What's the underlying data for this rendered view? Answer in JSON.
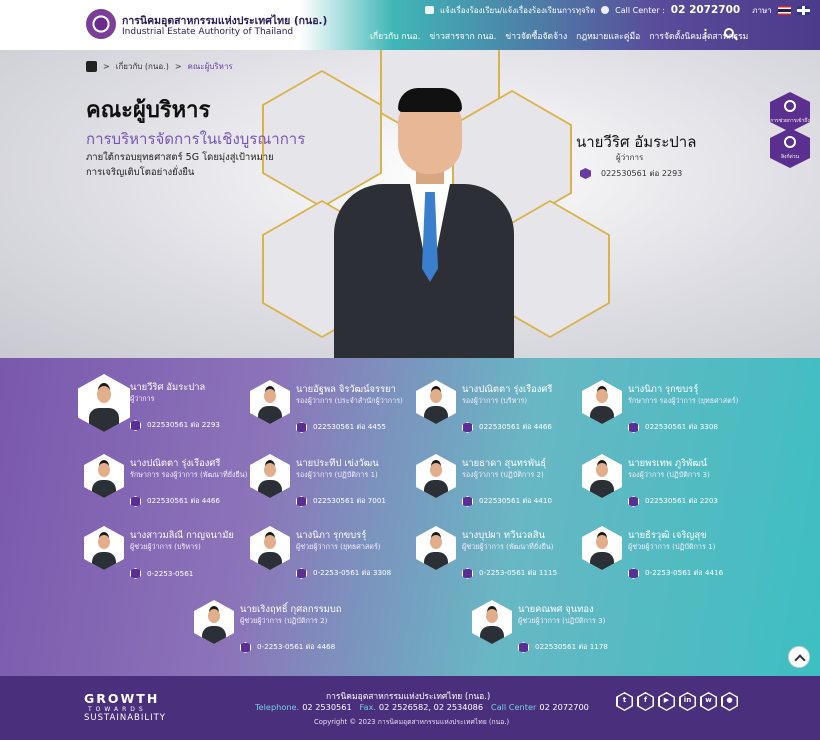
{
  "header": {
    "brand_th": "การนิคมอุตสาหกรรมแห่งประเทศไทย (กนอ.)",
    "brand_en": "Industrial Estate Authority of Thailand",
    "complaint_link": "แจ้งเรื่องร้องเรียน/แจ้งเรื่องร้องเรียนการทุจริต",
    "call_center_label": "Call Center :",
    "call_center_number": "02 2072700",
    "language_label": "ภาษา",
    "nav": [
      "เกี่ยวกับ กนอ.",
      "ข่าวสารจาก กนอ.",
      "ข่าวจัดซื้อจัดจ้าง",
      "กฎหมายและคู่มือ",
      "การจัดตั้งนิคมอุตสาหกรรม"
    ],
    "more_label": "⋮"
  },
  "breadcrumb": {
    "parent": "เกี่ยวกับ (กนอ.)",
    "current": "คณะผู้บริหาร",
    "separator": ">"
  },
  "hero": {
    "title": "คณะผู้บริหาร",
    "subtitle": "การบริหารจัดการในเชิงบูรณาการ",
    "description": "ภายใต้กรอบยุทธศาสตร์ 5G โดยมุ่งสู่เป้าหมายการเจริญเติบโตอย่างยั่งยืน",
    "name": "นายวีริศ อัมระปาล",
    "position": "ผู้ว่าการ",
    "phone": "022530561 ต่อ 2293"
  },
  "side_buttons": [
    "การช่วยการเข้าถึง",
    "ลิงก์ด่วน"
  ],
  "team": [
    {
      "name": "นายวีริศ อัมระปาล",
      "position": "ผู้ว่าการ",
      "phone": "022530561 ต่อ 2293"
    },
    {
      "name": "นายอัฐพล จิรวัฒน์จรรยา",
      "position": "รองผู้ว่าการ (ประจำสำนักผู้ว่าการ)",
      "phone": "022530561 ต่อ 4455"
    },
    {
      "name": "นางปณิตตา รุ่งเรืองศรี",
      "position": "รองผู้ว่าการ (บริหาร)",
      "phone": "022530561 ต่อ 4466"
    },
    {
      "name": "นางนิภา รุกขบรรุ์",
      "position": "รักษาการ รองผู้ว่าการ (ยุทธศาสตร์)",
      "phone": "022530561 ต่อ 3308"
    },
    {
      "name": "นางปณิตตา รุ่งเรืองศรี",
      "position": "รักษาการ รองผู้ว่าการ (พัฒนาที่ยั่งยืน)",
      "phone": "022530561 ต่อ 4466"
    },
    {
      "name": "นายประทีป เข่งวัฒน",
      "position": "รองผู้ว่าการ (ปฏิบัติการ 1)",
      "phone": "022530561 ต่อ 7001"
    },
    {
      "name": "นายธาดา สุนทรพันธุ์",
      "position": "รองผู้ว่าการ (ปฏิบัติการ 2)",
      "phone": "022530561 ต่อ 4410"
    },
    {
      "name": "นายพรเทพ ภูริพัฒน์",
      "position": "รองผู้ว่าการ (ปฏิบัติการ 3)",
      "phone": "022530561 ต่อ 2203"
    },
    {
      "name": "นางสาวมลิณี กาญจนามัย",
      "position": "ผู้ช่วยผู้ว่าการ (บริหาร)",
      "phone": "0-2253-0561"
    },
    {
      "name": "นางนิภา รุกขบรรุ์",
      "position": "ผู้ช่วยผู้ว่าการ (ยุทธศาสตร์)",
      "phone": "0-2253-0561 ต่อ 3308"
    },
    {
      "name": "นางบุปผา ทวีนวลสิน",
      "position": "ผู้ช่วยผู้ว่าการ (พัฒนาที่ยั่งยืน)",
      "phone": "0-2253-0561 ต่อ 1115"
    },
    {
      "name": "นายธีรวุฒิ เจริญสุข",
      "position": "ผู้ช่วยผู้ว่าการ (ปฏิบัติการ 1)",
      "phone": "0-2253-0561 ต่อ 4416"
    },
    {
      "name": "นายเริงฤทธิ์ กุศลกรรมบถ",
      "position": "ผู้ช่วยผู้ว่าการ (ปฏิบัติการ 2)",
      "phone": "0-2253-0561 ต่อ 4468"
    },
    {
      "name": "นายคณพศ จุนทอง",
      "position": "ผู้ช่วยผู้ว่าการ (ปฏิบัติการ 3)",
      "phone": "022530561 ต่อ 1178"
    }
  ],
  "footer": {
    "slogan_1": "GROWTH",
    "slogan_2": "TOWARDS",
    "slogan_3": "SUSTAINABILITY",
    "org": "การนิคมอุตสาหกรรมแห่งประเทศไทย (กนอ.)",
    "telephone_label": "Telephone.",
    "telephone": "02 2530561",
    "fax_label": "Fax.",
    "fax": "02 2526582, 02 2534086",
    "call_label": "Call Center",
    "call": "02 2072700",
    "copyright": "Copyright © 2023 การนิคมอุตสาหกรรมแห่งประเทศไทย (กนอ.)",
    "socials": [
      "twitter",
      "facebook",
      "youtube",
      "linkedin",
      "weibo",
      "wechat"
    ]
  }
}
